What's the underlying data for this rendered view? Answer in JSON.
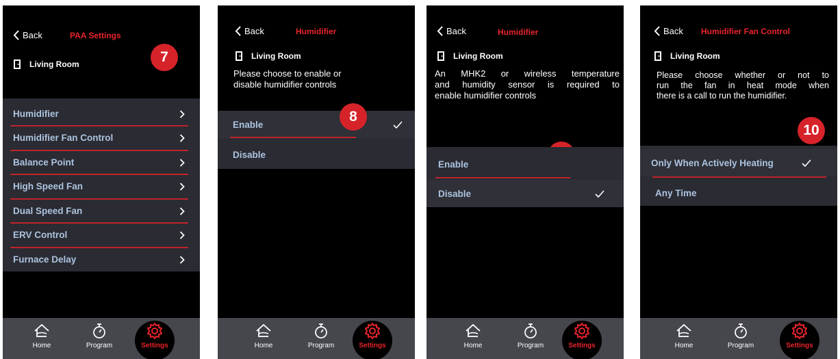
{
  "colors": {
    "accent": "#e8232b",
    "badge": "#d6232a",
    "menu_text": "#adc3df",
    "nav_bg": "#46474d"
  },
  "nav": {
    "home": "Home",
    "program": "Program",
    "settings": "Settings"
  },
  "screen1": {
    "back": "Back",
    "title": "PAA Settings",
    "room": "Living Room",
    "badge": "7",
    "items": [
      {
        "label": "Humidifier"
      },
      {
        "label": "Humidifier Fan Control"
      },
      {
        "label": "Balance Point"
      },
      {
        "label": "High Speed Fan"
      },
      {
        "label": "Dual Speed Fan"
      },
      {
        "label": "ERV Control"
      },
      {
        "label": "Furnace Delay"
      }
    ]
  },
  "screen2": {
    "back": "Back",
    "title": "Humidifier",
    "room": "Living Room",
    "desc_line1": "Please choose to enable or",
    "desc_line2": "disable humidifier controls",
    "badge": "8",
    "options": [
      {
        "label": "Enable",
        "selected": true
      },
      {
        "label": "Disable",
        "selected": false
      }
    ]
  },
  "screen3": {
    "back": "Back",
    "title": "Humidifier",
    "room": "Living Room",
    "desc_line1": "An MHK2 or wireless temperature",
    "desc_line2": "and humidity sensor is required to",
    "desc_line3": "enable humidifier controls",
    "badge": "9",
    "options": [
      {
        "label": "Enable",
        "selected": false
      },
      {
        "label": "Disable",
        "selected": true
      }
    ]
  },
  "screen4": {
    "back": "Back",
    "title": "Humidifier Fan Control",
    "room": "Living Room",
    "desc_line1": "Please choose whether or not to",
    "desc_line2": "run the fan in heat mode when",
    "desc_line3": "there is a call to run the humidifier.",
    "badge": "10",
    "options": [
      {
        "label": "Only When Actively Heating",
        "selected": true
      },
      {
        "label": "Any Time",
        "selected": false
      }
    ]
  }
}
